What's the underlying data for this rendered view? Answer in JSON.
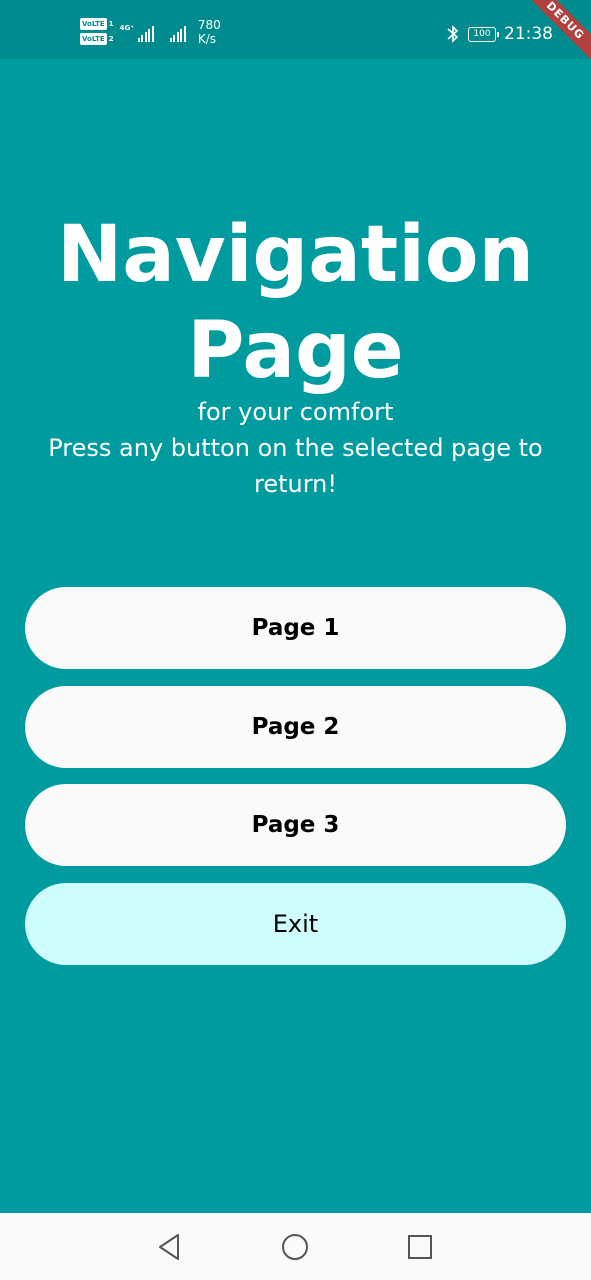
{
  "status_bar": {
    "volte1": "VoLTE",
    "sim1": "1",
    "volte2": "VoLTE",
    "sim2": "2",
    "network": "4G⁺",
    "speed_value": "780",
    "speed_unit": "K/s",
    "bluetooth_icon": "bluetooth-icon",
    "battery_level": "100",
    "time": "21:38"
  },
  "debug_banner": "DEBUG",
  "title": {
    "line1": "Navigation",
    "line2": "Page"
  },
  "subtitle": {
    "line1": "for your comfort",
    "line2": "Press any button on the selected page to return!"
  },
  "buttons": [
    {
      "label": "Page 1"
    },
    {
      "label": "Page 2"
    },
    {
      "label": "Page 3"
    },
    {
      "label": "Exit"
    }
  ],
  "colors": {
    "background": "#009b9e",
    "status_bar": "#008c8e",
    "button": "#fafafa",
    "exit_button": "#cffcfc",
    "debug_ribbon": "#b0413e"
  },
  "nav_bar": {
    "back_icon": "triangle-back-icon",
    "home_icon": "circle-home-icon",
    "recent_icon": "square-recents-icon"
  }
}
